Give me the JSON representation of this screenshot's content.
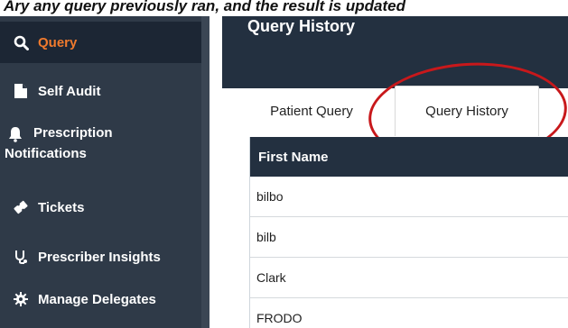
{
  "caption": "…y any 0 any query previously …d. …a the Tesult 0 updated …p…",
  "sidebar": {
    "items": [
      {
        "label": "Query",
        "icon": "search-icon",
        "active": true
      },
      {
        "label": "Self Audit",
        "icon": "document-icon"
      },
      {
        "label": "Prescription Notifications",
        "line1": "Prescription",
        "line2": "Notifications",
        "icon": "bell-icon"
      },
      {
        "label": "Tickets",
        "icon": "ticket-icon"
      },
      {
        "label": "Prescriber Insights",
        "icon": "stethoscope-icon"
      },
      {
        "label": "Manage Delegates",
        "icon": "gear-icon"
      }
    ]
  },
  "header": {
    "title": "Query History"
  },
  "tabs": [
    {
      "label": "Patient Query"
    },
    {
      "label": "Query History",
      "active": true
    }
  ],
  "table": {
    "columns": [
      "First Name"
    ],
    "rows": [
      "bilbo",
      "bilb",
      "Clark",
      "FRODO"
    ]
  },
  "colors": {
    "accent": "#f07a2d",
    "sidebar": "#2f3a48",
    "header": "#233040",
    "annotation": "#c8181b"
  }
}
